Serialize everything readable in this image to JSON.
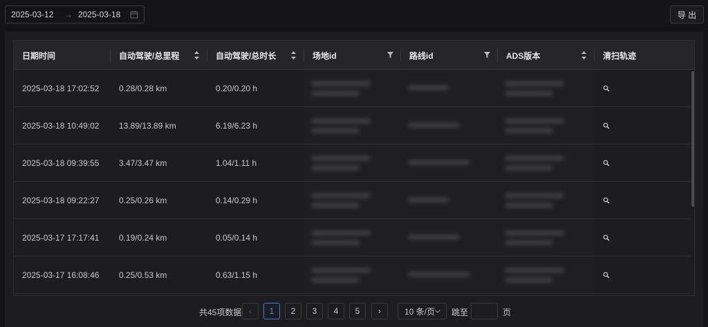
{
  "filters": {
    "start_date": "2025-03-12",
    "range_arrow": "→",
    "end_date": "2025-03-18",
    "calendar_icon": "calendar-icon"
  },
  "toolbar": {
    "export_label": "导 出"
  },
  "table": {
    "columns": [
      {
        "label": "日期时间",
        "control": "none"
      },
      {
        "label": "自动驾驶/总里程",
        "control": "sort"
      },
      {
        "label": "自动驾驶/总时长",
        "control": "sort"
      },
      {
        "label": "场地id",
        "control": "filter"
      },
      {
        "label": "路线id",
        "control": "filter"
      },
      {
        "label": "ADS版本",
        "control": "sort"
      },
      {
        "label": "清扫轨迹",
        "control": "none"
      }
    ],
    "rows": [
      {
        "datetime": "2025-03-18 17:02:52",
        "mileage": "0.28/0.28 km",
        "duration": "0.20/0.20 h"
      },
      {
        "datetime": "2025-03-18 10:49:02",
        "mileage": "13.89/13.89 km",
        "duration": "6.19/6.23 h"
      },
      {
        "datetime": "2025-03-18 09:39:55",
        "mileage": "3.47/3.47 km",
        "duration": "1.04/1.11 h"
      },
      {
        "datetime": "2025-03-18 09:22:27",
        "mileage": "0.25/0.26 km",
        "duration": "0.14/0.29 h"
      },
      {
        "datetime": "2025-03-17 17:17:41",
        "mileage": "0.19/0.24 km",
        "duration": "0.05/0.14 h"
      },
      {
        "datetime": "2025-03-17 16:08:46",
        "mileage": "0.25/0.53 km",
        "duration": "0.63/1.15 h"
      }
    ]
  },
  "pagination": {
    "total_label": "共45项数据",
    "prev": "‹",
    "next": "›",
    "pages": [
      "1",
      "2",
      "3",
      "4",
      "5"
    ],
    "current_page": "1",
    "page_size_label": "10 条/页",
    "jump_label": "跳至",
    "page_suffix": "页"
  },
  "colors": {
    "accent": "#3b7de6",
    "background": "#141416",
    "panel": "#1d1d21"
  }
}
